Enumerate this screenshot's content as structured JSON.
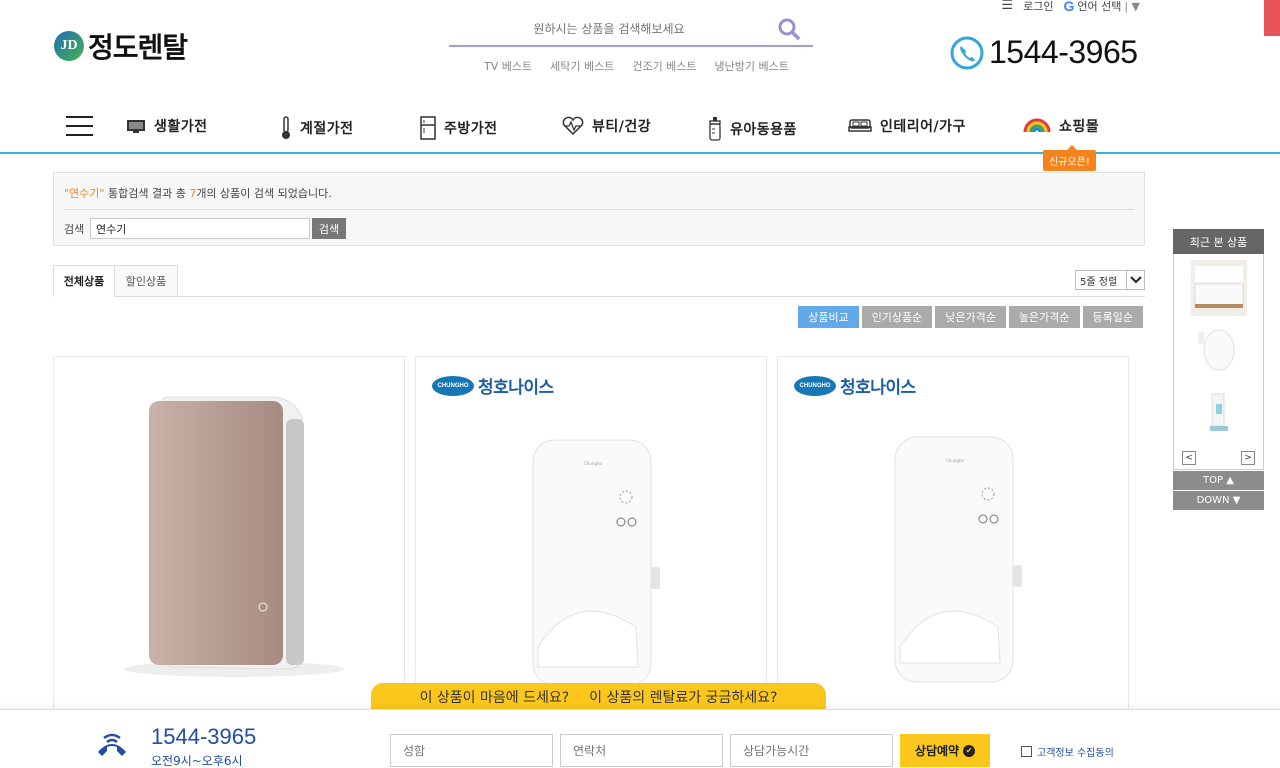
{
  "utility": {
    "login": "로그인",
    "language": "언어 선택",
    "google_letter": "G"
  },
  "logo": {
    "mark": "JD",
    "name": "정도렌탈"
  },
  "search": {
    "placeholder": "원하시는 상품을 검색해보세요",
    "quick_links": [
      "TV 베스트",
      "세탁기 베스트",
      "건조기 베스트",
      "냉난방기 베스트"
    ]
  },
  "phone": {
    "number": "1544-3965"
  },
  "nav": {
    "items": [
      {
        "label": "생활가전",
        "icon": "tv-icon"
      },
      {
        "label": "계절가전",
        "icon": "thermometer-icon"
      },
      {
        "label": "주방가전",
        "icon": "fridge-icon"
      },
      {
        "label": "뷰티/건강",
        "icon": "heartbeat-icon"
      },
      {
        "label": "유아동용품",
        "icon": "baby-bottle-icon"
      },
      {
        "label": "인테리어/가구",
        "icon": "bed-icon"
      },
      {
        "label": "쇼핑몰",
        "icon": "rainbow-icon"
      }
    ],
    "new_badge": "신규오픈!"
  },
  "results": {
    "keyword_quoted": "\"연수기\"",
    "msg_middle": " 통합검색 결과 총 ",
    "count": "7",
    "msg_end": "개의 상품이 검색 되었습니다.",
    "search_label": "검색",
    "search_value": "연수기",
    "search_button": "검색"
  },
  "tabs": {
    "all": "전체상품",
    "discount": "할인상품",
    "sort_select": "5줄 정렬"
  },
  "sort_buttons": [
    "상품비교",
    "인기상품순",
    "낮은가격순",
    "높은가격순",
    "등록일순"
  ],
  "products": [
    {
      "brand": ""
    },
    {
      "brand": "청호나이스",
      "brand_en": "CHUNGHO"
    },
    {
      "brand": "청호나이스",
      "brand_en": "CHUNGHO"
    }
  ],
  "recent": {
    "title": "최근 본 상품",
    "top": "TOP ▲",
    "down": "DOWN ▼",
    "prev": "<",
    "next": ">"
  },
  "consult": {
    "q1": "이 상품이 마음에 드세요?",
    "q2": "이 상품의 렌탈료가 궁금하세요?",
    "phone": "1544-3965",
    "hours": "오전9시~오후6시",
    "name_placeholder": "성함",
    "contact_placeholder": "연락처",
    "time_placeholder": "상담가능시간",
    "submit": "상담예약",
    "agree": "고객정보 수집동의"
  },
  "colors": {
    "accent": "#35b3d8",
    "orange": "#f5841f",
    "yellow": "#fcc71c",
    "navy": "#234ca3",
    "search_line": "#a49ad8"
  }
}
